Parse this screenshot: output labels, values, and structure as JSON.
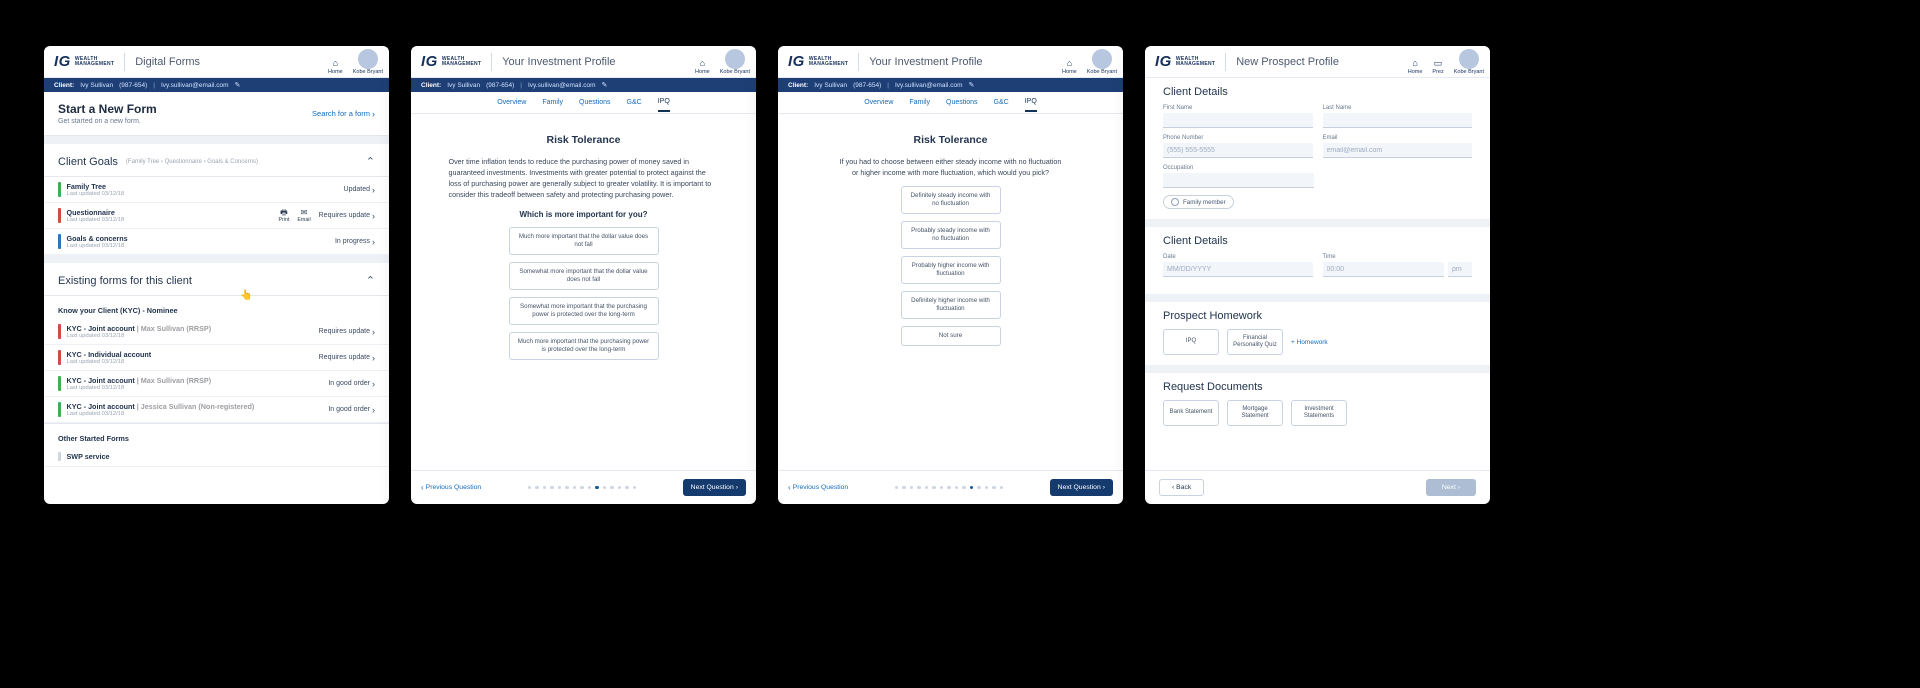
{
  "brand": {
    "ig": "IG",
    "line1": "WEALTH",
    "line2": "MANAGEMENT"
  },
  "user": {
    "name": "Kobe Bryant"
  },
  "nav": {
    "home": "Home",
    "prez": "Prez"
  },
  "client": {
    "label": "Client:",
    "name": "Ivy Sullivan",
    "phone": "(987-654)",
    "email": "Ivy.sullivan@email.com"
  },
  "p1": {
    "title": "Digital Forms",
    "start": {
      "head": "Start a New Form",
      "sub": "Get started on a new form.",
      "search": "Search for a form"
    },
    "goals": {
      "head": "Client Goals",
      "crumbs": "(Family Tree › Questionnaire › Goals & Concerns)",
      "items": [
        {
          "title": "Family Tree",
          "sub": "Last updated 03/12/18",
          "status": "Updated",
          "bar": "green"
        },
        {
          "title": "Questionnaire",
          "sub": "Last updated 03/12/18",
          "status": "Requires update",
          "bar": "red",
          "print": "Print",
          "email": "Email"
        },
        {
          "title": "Goals & concerns",
          "sub": "Last updated 03/12/18",
          "status": "In progress",
          "bar": "blue"
        }
      ]
    },
    "existing": {
      "head": "Existing forms for this client",
      "group1": "Know your Client (KYC) - Nominee",
      "rows": [
        {
          "title": "KYC - Joint account",
          "meta": "Max Sullivan (RRSP)",
          "sub": "Last updated 03/12/18",
          "status": "Requires update",
          "bar": "red"
        },
        {
          "title": "KYC - Individual account",
          "meta": "",
          "sub": "Last updated 03/12/18",
          "status": "Requires update",
          "bar": "red"
        },
        {
          "title": "KYC - Joint account",
          "meta": "Max Sullivan (RRSP)",
          "sub": "Last updated 03/12/18",
          "status": "In good order",
          "bar": "green"
        },
        {
          "title": "KYC - Joint account",
          "meta": "Jessica Sullivan (Non-registered)",
          "sub": "Last updated 03/12/18",
          "status": "In good order",
          "bar": "green"
        }
      ],
      "group2": "Other Started Forms",
      "swp": "SWP service"
    }
  },
  "tabs": {
    "overview": "Overview",
    "family": "Family",
    "questions": "Questions",
    "gc": "G&C",
    "ipq": "IPQ"
  },
  "p2": {
    "title": "Your Investment Profile",
    "h": "Risk Tolerance",
    "desc": "Over time inflation tends to reduce the purchasing power of money saved in guaranteed investments. Investments with greater potential to protect against the loss of purchasing power are generally subject to greater volatility. It is important to consider this tradeoff  between safety and protecting purchasing power.",
    "prompt": "Which is more important for you?",
    "opts": [
      "Much more important that the dollar value does not fall",
      "Somewhat more important that the dollar value does not fall",
      "Somewhat more important that the purchasing power is protected over the long-term",
      "Much more important that the purchasing power is protected over the long-term"
    ],
    "prev": "Previous Question",
    "next": "Next Question",
    "activeDot": 9,
    "dotCount": 15
  },
  "p3": {
    "title": "Your Investment Profile",
    "h": "Risk Tolerance",
    "desc": "If you had to choose between either steady income with no fluctuation or higher income with more fluctuation, which would you pick?",
    "opts": [
      "Definitely steady income with no fluctuation",
      "Probably steady income with no fluctuation",
      "Probably higher income with fluctuation",
      "Definitely higher income with fluctuation",
      "Not sure"
    ],
    "prev": "Previous Question",
    "next": "Next Question",
    "activeDot": 10,
    "dotCount": 15
  },
  "p4": {
    "title": "New Prospect Profile",
    "s1": {
      "head": "Client Details",
      "first": "First Name",
      "last": "Last Name",
      "phone": "Phone Number",
      "phone_ph": "(555) 555-5555",
      "email": "Email",
      "email_ph": "email@email.com",
      "occ": "Occupation",
      "chip": "Family member"
    },
    "s2": {
      "head": "Client Details",
      "date": "Date",
      "date_ph": "MM/DD/YYYY",
      "time": "Time",
      "time_h": "00:00",
      "time_m": "pm"
    },
    "s3": {
      "head": "Prospect Homework",
      "t1": "IPQ",
      "t2": "Financial Personality Quiz",
      "add": "+   Homework"
    },
    "s4": {
      "head": "Request Documents",
      "t1": "Bank Statement",
      "t2": "Mortgage Statement",
      "t3": "Investment Statements"
    },
    "back": "Back",
    "next": "Next"
  }
}
